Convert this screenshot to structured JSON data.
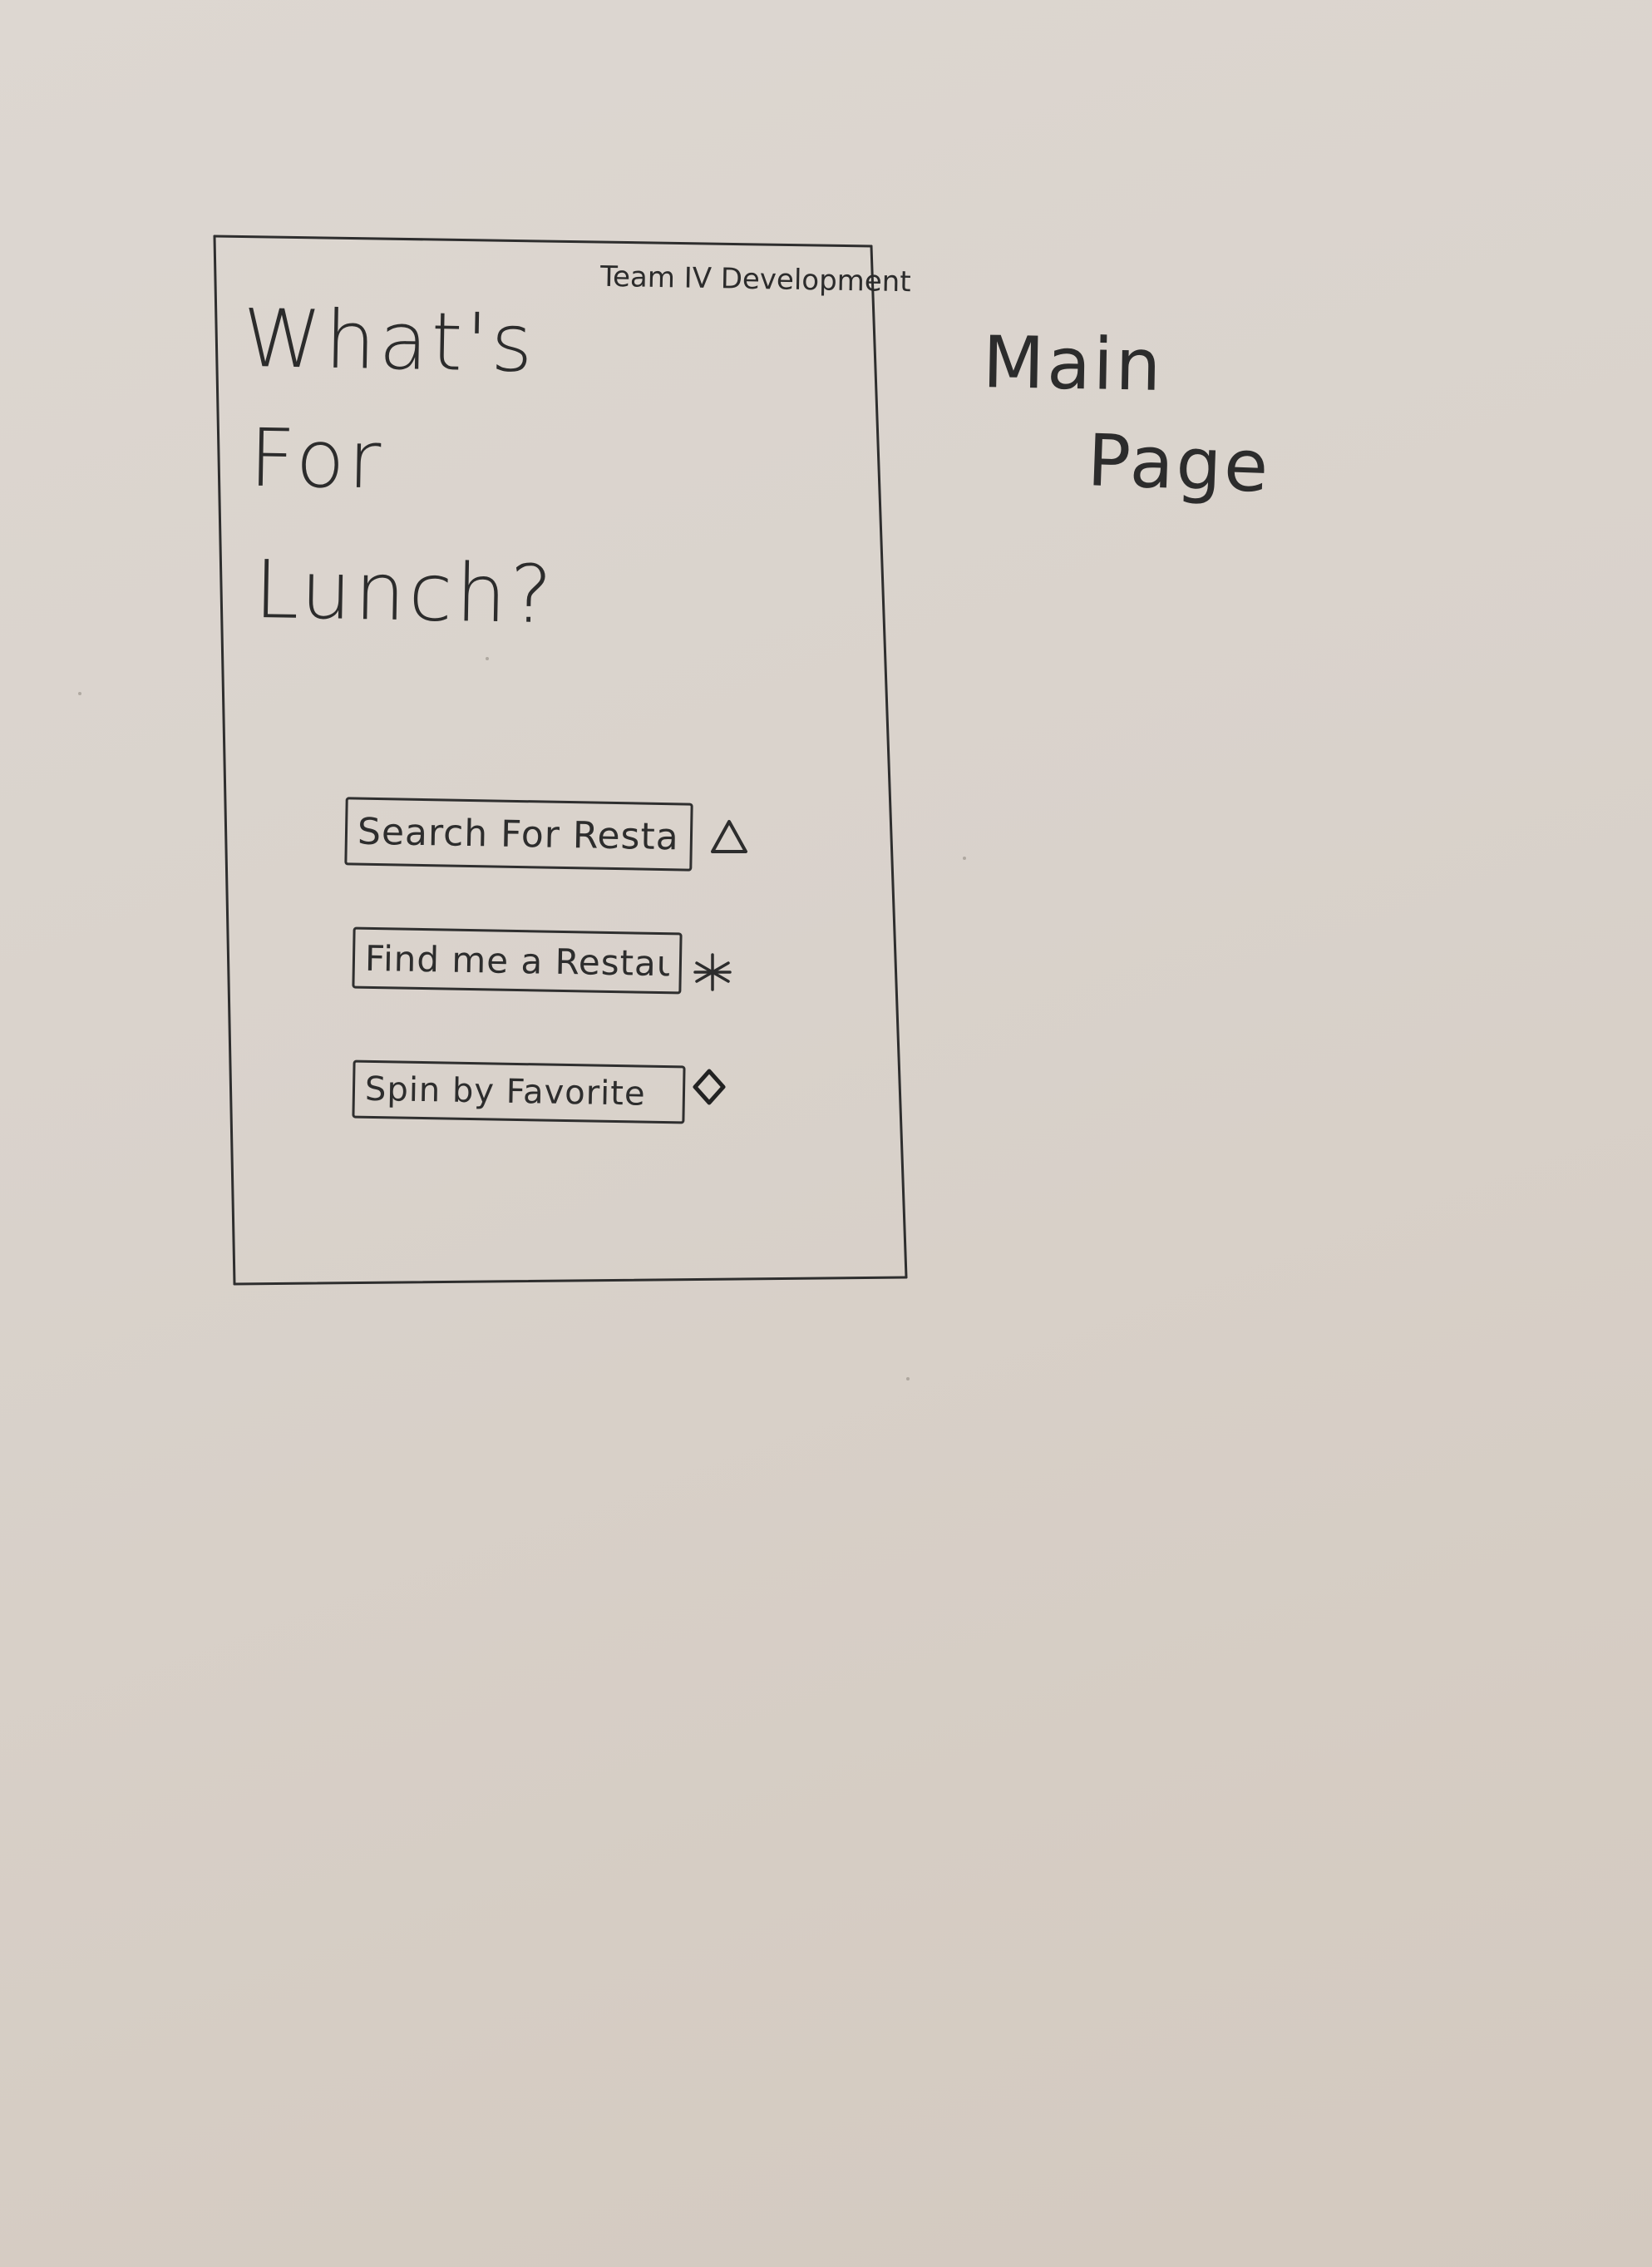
{
  "app": {
    "developer_credit": "Team IV Development",
    "title_lines": [
      "What's",
      "For",
      "Lunch?"
    ]
  },
  "annotation": {
    "lines": [
      "Main",
      "Page"
    ]
  },
  "buttons": {
    "search": {
      "label": "Search For Restaurant",
      "icon": "triangle-icon"
    },
    "find": {
      "label": "Find me a Restaurant",
      "icon": "asterisk-icon"
    },
    "spin": {
      "label": "Spin by Favorite",
      "icon": "diamond-icon"
    }
  }
}
